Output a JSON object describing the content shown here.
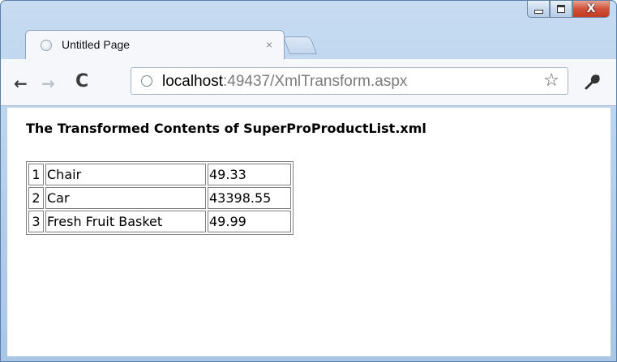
{
  "window": {
    "minimize_glyph": "",
    "close_glyph": "X"
  },
  "tab": {
    "title": "Untitled Page",
    "close_glyph": "×"
  },
  "toolbar": {
    "back_glyph": "←",
    "forward_glyph": "→",
    "reload_glyph": "C",
    "url_host": "localhost",
    "url_rest": ":49437/XmlTransform.aspx",
    "star_glyph": "☆",
    "wrench_glyph": "🔧"
  },
  "page": {
    "heading": "The Transformed Contents of SuperProProductList.xml",
    "rows": [
      {
        "index": "1",
        "name": "Chair",
        "price": "49.33"
      },
      {
        "index": "2",
        "name": "Car",
        "price": "43398.55"
      },
      {
        "index": "3",
        "name": "Fresh Fruit Basket",
        "price": "49.99"
      }
    ]
  },
  "colors": {
    "window_frame": "#b3cde9",
    "close_button": "#c43a22",
    "table_border": "#808080"
  }
}
